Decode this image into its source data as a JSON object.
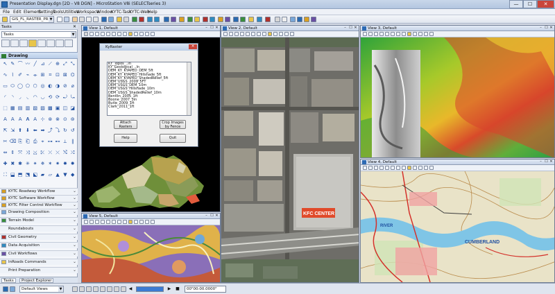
{
  "window": {
    "title": "Presentation Display.dgn [2D - V8 DGN] - MicroStation V8i (SELECTseries 3)",
    "min": "—",
    "max": "☐",
    "close": "✕"
  },
  "menu": [
    "File",
    "Edit",
    "Element",
    "Settings",
    "Tools",
    "Utilities",
    "Workspace",
    "Window",
    "KYTC-Task",
    "KYTC-Web",
    "Help"
  ],
  "toolbar": {
    "level_combo": "GIS_FL_RASTER_PR",
    "colors": [
      "#2a6ab0",
      "#d9a022",
      "#3b8e3d",
      "#b0312b",
      "#6b4fa3",
      "#2f8bbf"
    ]
  },
  "tasks_panel": {
    "header": "Tasks",
    "close": "✕",
    "combo": "Tasks",
    "section": "Drawing",
    "tool_glyphs": [
      "↖",
      "✎",
      "⌒",
      "〰",
      "╱",
      "⊿",
      "⟋",
      "⊕",
      "⤢",
      "⤡",
      "∿",
      "⌇",
      "✐",
      "⌁",
      "⌯",
      "⊞",
      "⌗",
      "⊡",
      "⊠",
      "⌬",
      "▭",
      "⬭",
      "◯",
      "⬠",
      "⬡",
      "◎",
      "◐",
      "◑",
      "⊘",
      "⌀",
      "◜",
      "◝",
      "◞",
      "◟",
      "◠",
      "◡",
      "⟲",
      "⟳",
      "⤾",
      "⤿",
      "⬚",
      "▦",
      "▤",
      "▥",
      "▧",
      "▨",
      "▩",
      "▣",
      "◫",
      "◪",
      "A",
      "A",
      "A",
      "𝐀",
      "A",
      "⊹",
      "⊛",
      "⊗",
      "⊙",
      "⊚",
      "⇱",
      "⇲",
      "⬆",
      "⬇",
      "⬅",
      "➡",
      "⤴",
      "⤵",
      "↻",
      "↺",
      "✂",
      "⌫",
      "⎘",
      "⎗",
      "⎙",
      "⌖",
      "⊶",
      "⊷",
      "⟂",
      "∥",
      "⇔",
      "⇕",
      "⤧",
      "⤨",
      "⤩",
      "⤪",
      "⤫",
      "⤬",
      "⤭",
      "⤮",
      "✚",
      "✖",
      "✱",
      "✳",
      "✴",
      "✵",
      "✶",
      "✷",
      "✸",
      "✹",
      "⛶",
      "⬓",
      "⬒",
      "⬔",
      "⬕",
      "▰",
      "▱",
      "▲",
      "▼",
      "◆"
    ],
    "items": [
      {
        "label": "KYTC Roadway Workflow"
      },
      {
        "label": "KYTC Software Workflow"
      },
      {
        "label": "KYTC Filter Control Workflow"
      },
      {
        "label": "Drawing Composition"
      },
      {
        "label": "Terrain Model"
      },
      {
        "label": "Roundabouts"
      },
      {
        "label": "Civil Geometry"
      },
      {
        "label": "Data Acquisition"
      },
      {
        "label": "Civil Workflows"
      },
      {
        "label": "InRoads Commands"
      },
      {
        "label": "Print Preparation"
      }
    ],
    "tabs": [
      "Tasks",
      "Project Explorer"
    ]
  },
  "views": [
    {
      "title": "View 1, Default"
    },
    {
      "title": "View 2, Default"
    },
    {
      "title": "View 3, Default"
    },
    {
      "title": "View 4, Default"
    },
    {
      "title": "View 5, Default"
    }
  ],
  "map_labels": {
    "kfc_center": "KFC CENTER",
    "cumberland": "CUMBERLAND",
    "river": "RIVER"
  },
  "dialog": {
    "title": "KyRaster",
    "close": "✕",
    "layers": [
      "KY_Topos_..ln",
      "KY_Geological_..ln",
      "DEM_KY_KYAPED_DEM_5ft",
      "DEM_KY_KYAPED_Hillshade_5ft",
      "DEM_KY_KYAPED_ShadedRelief_5ft",
      "DEM_USGS_2009_5FT",
      "DEM_USGS_DEM_10m",
      "DEM_USGS_Hillshade_10m",
      "DEM_USGS_ShadedRelief_10m",
      "Benton_2005_1ft",
      "Boone_2007_3in",
      "Butle_2009_1ft",
      "Clark_2011_1ft"
    ],
    "attach_label": "Attach\nRasters",
    "crop_label": "Crop Images\nby Fence",
    "help_label": "Help",
    "quit_label": "Quit"
  },
  "status": {
    "views_combo": "Default Views",
    "progress_percent": 100,
    "time": "00\"00:00.0000\""
  }
}
